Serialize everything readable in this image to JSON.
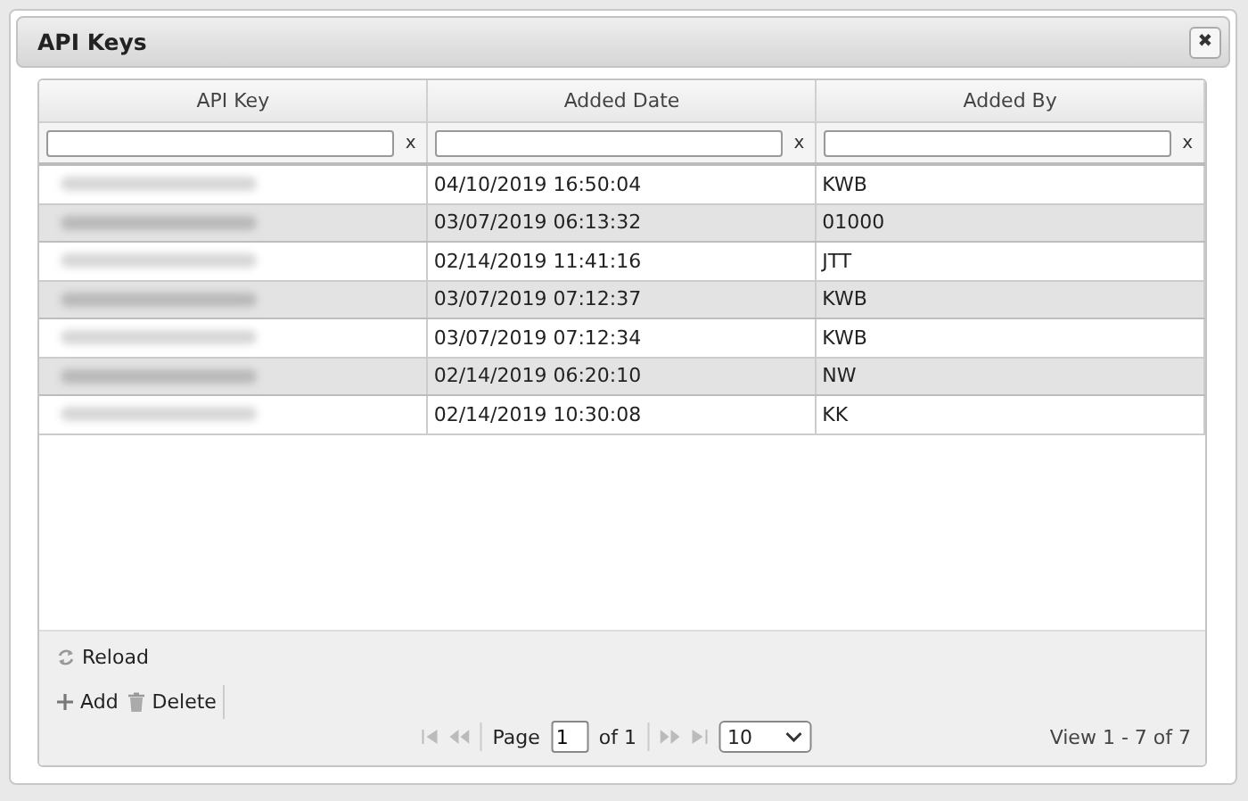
{
  "dialog": {
    "title": "API Keys",
    "close_icon": "✖"
  },
  "table": {
    "columns": [
      {
        "label": "API Key",
        "filter_clear": "x"
      },
      {
        "label": "Added Date",
        "filter_clear": "x"
      },
      {
        "label": "Added By",
        "filter_clear": "x"
      }
    ],
    "rows": [
      {
        "api_key_redacted": true,
        "added_date": "04/10/2019 16:50:04",
        "added_by": "KWB"
      },
      {
        "api_key_redacted": true,
        "added_date": "03/07/2019 06:13:32",
        "added_by": "01000"
      },
      {
        "api_key_redacted": true,
        "added_date": "02/14/2019 11:41:16",
        "added_by": "JTT"
      },
      {
        "api_key_redacted": true,
        "added_date": "03/07/2019 07:12:37",
        "added_by": "KWB"
      },
      {
        "api_key_redacted": true,
        "added_date": "03/07/2019 07:12:34",
        "added_by": "KWB"
      },
      {
        "api_key_redacted": true,
        "added_date": "02/14/2019 06:20:10",
        "added_by": "NW"
      },
      {
        "api_key_redacted": true,
        "added_date": "02/14/2019 10:30:08",
        "added_by": "KK"
      }
    ]
  },
  "toolbar": {
    "reload": "Reload",
    "add": "Add",
    "delete": "Delete"
  },
  "pager": {
    "page_label": "Page",
    "page": "1",
    "of_label": "of 1",
    "page_size": "10",
    "view": "View 1 - 7 of 7"
  }
}
